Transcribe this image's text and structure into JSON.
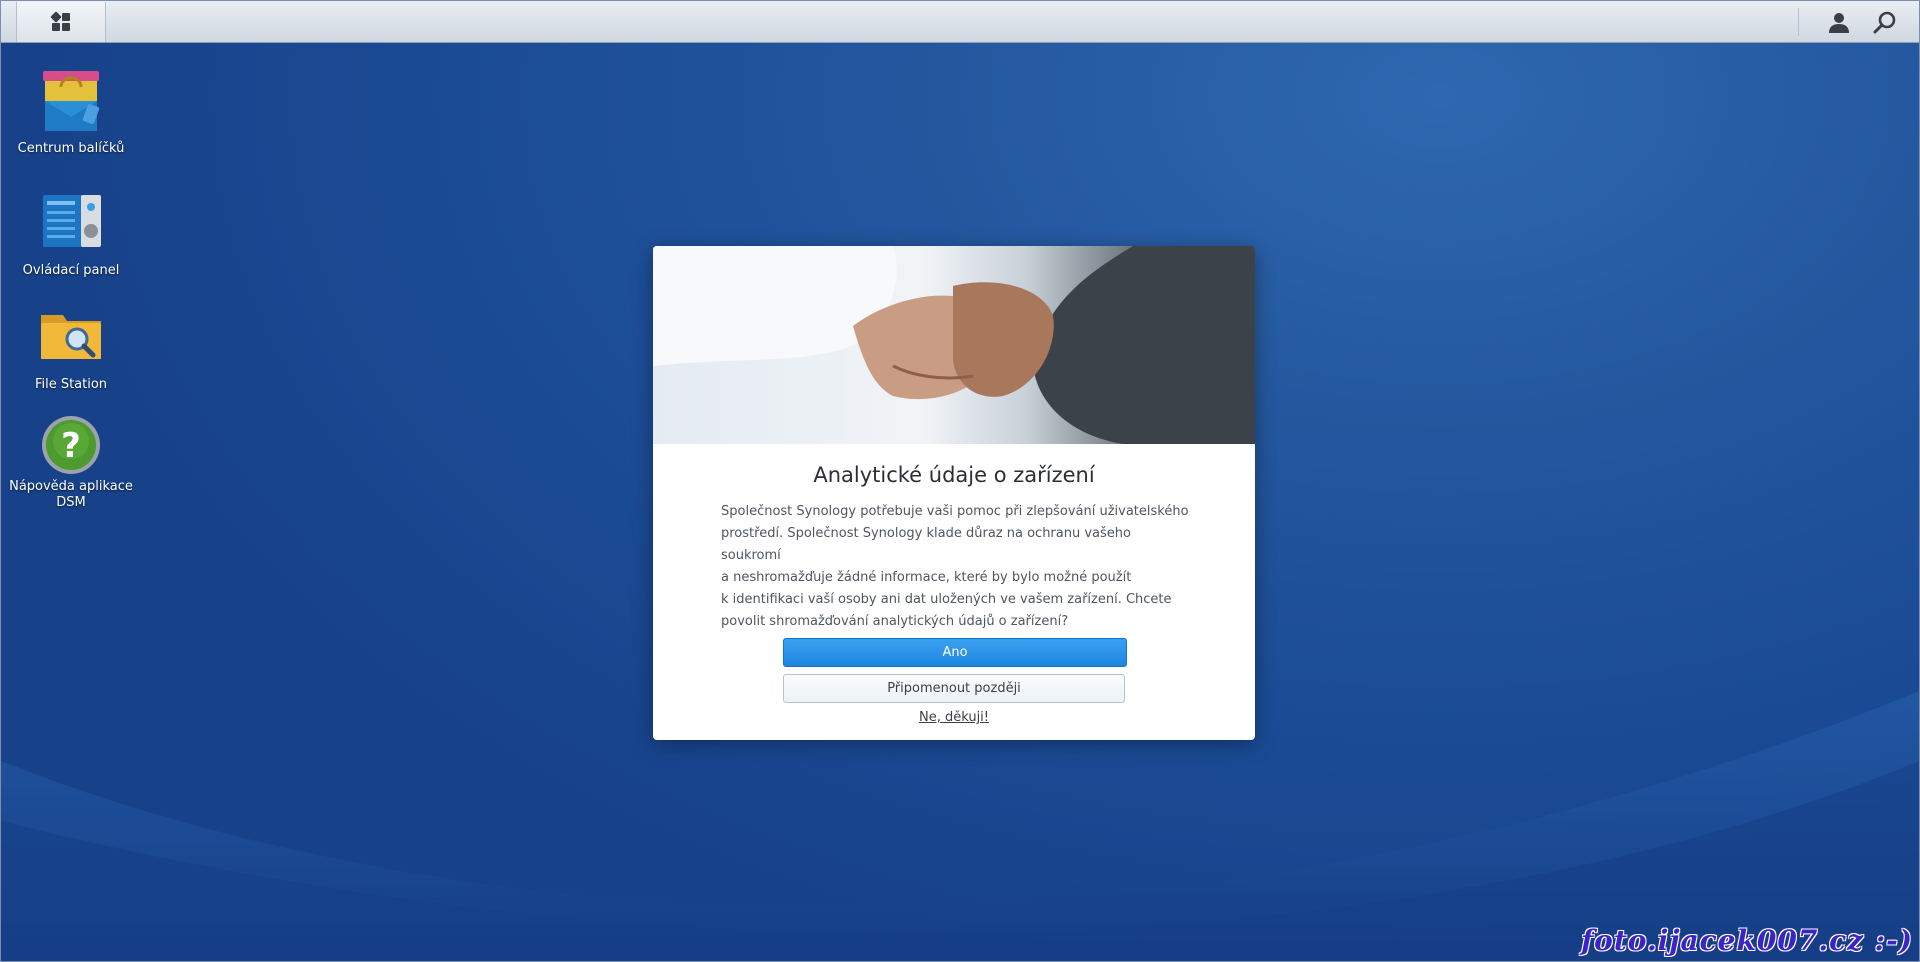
{
  "taskbar": {
    "main_menu_icon": "grid-menu-icon",
    "user_icon": "user-icon",
    "search_icon": "search-icon"
  },
  "desktop": {
    "icons": [
      {
        "label": "Centrum balíčků",
        "icon": "package-center-icon"
      },
      {
        "label": "Ovládací panel",
        "icon": "control-panel-icon"
      },
      {
        "label": "File Station",
        "icon": "file-station-icon"
      },
      {
        "label": "Nápověda aplikace DSM",
        "icon": "help-icon"
      }
    ]
  },
  "dialog": {
    "hero_image": "handshake-photo",
    "title": "Analytické údaje o zařízení",
    "body_lines": [
      "Společnost Synology potřebuje vaši pomoc při zlepšování uživatelského",
      "prostředí. Společnost Synology klade důraz na ochranu vašeho soukromí",
      "a neshromažďuje žádné informace, které by bylo možné použít",
      "k identifikaci vaší osoby ani dat uložených ve vašem zařízení. Chcete",
      "povolit shromažďování analytických údajů o zařízení?"
    ],
    "yes_label": "Ano",
    "later_label": "Připomenout později",
    "no_label": "Ne, děkuji!"
  },
  "watermark": "foto.ijacek007.cz :-)",
  "colors": {
    "desktop_bg": "#1e4e96",
    "primary_button": "#2a92e8",
    "watermark": "#3d22c9"
  }
}
